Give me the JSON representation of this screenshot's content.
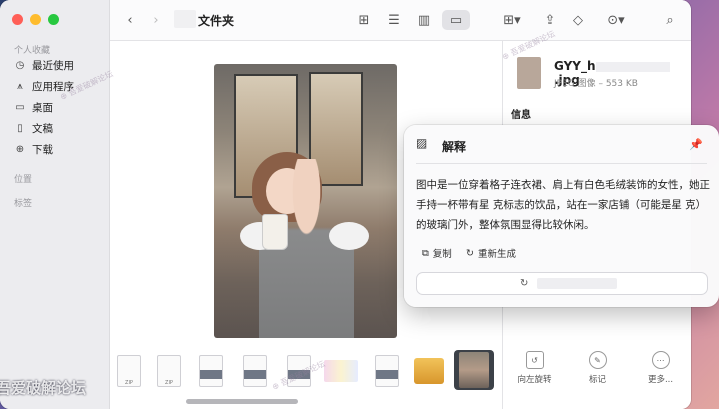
{
  "window": {
    "title": "文件夹"
  },
  "sidebar": {
    "section_personal": "个人收藏",
    "items": [
      {
        "label": "最近使用",
        "icon": "clock-icon"
      },
      {
        "label": "应用程序",
        "icon": "apps-icon"
      },
      {
        "label": "桌面",
        "icon": "desktop-icon"
      },
      {
        "label": "文稿",
        "icon": "document-icon"
      },
      {
        "label": "下载",
        "icon": "download-icon"
      }
    ],
    "section_location": "位置",
    "section_tags": "标签"
  },
  "inspector": {
    "filename_prefix": "GYY_h",
    "filename_suffix": ".jpg",
    "meta": "JPEG 图像 – 553 KB",
    "info_heading": "信息",
    "actions": [
      {
        "label": "向左旋转",
        "icon": "rotate-left-icon"
      },
      {
        "label": "标记",
        "icon": "markup-icon"
      },
      {
        "label": "更多...",
        "icon": "more-icon"
      }
    ]
  },
  "popup": {
    "title": "解释",
    "body": "图中是一位穿着格子连衣裙、肩上有白色毛绒装饰的女性，她正手持一杯带有星 克标志的饮品，站在一家店铺（可能是星 克）的玻璃门外，整体氛围显得比较休闲。",
    "copy_label": "复制",
    "regenerate_label": "重新生成"
  },
  "thumbnails": [
    "ZIP",
    "ZIP",
    "",
    "",
    "",
    "",
    "",
    "",
    ""
  ],
  "watermark": "吾爱破解论坛"
}
